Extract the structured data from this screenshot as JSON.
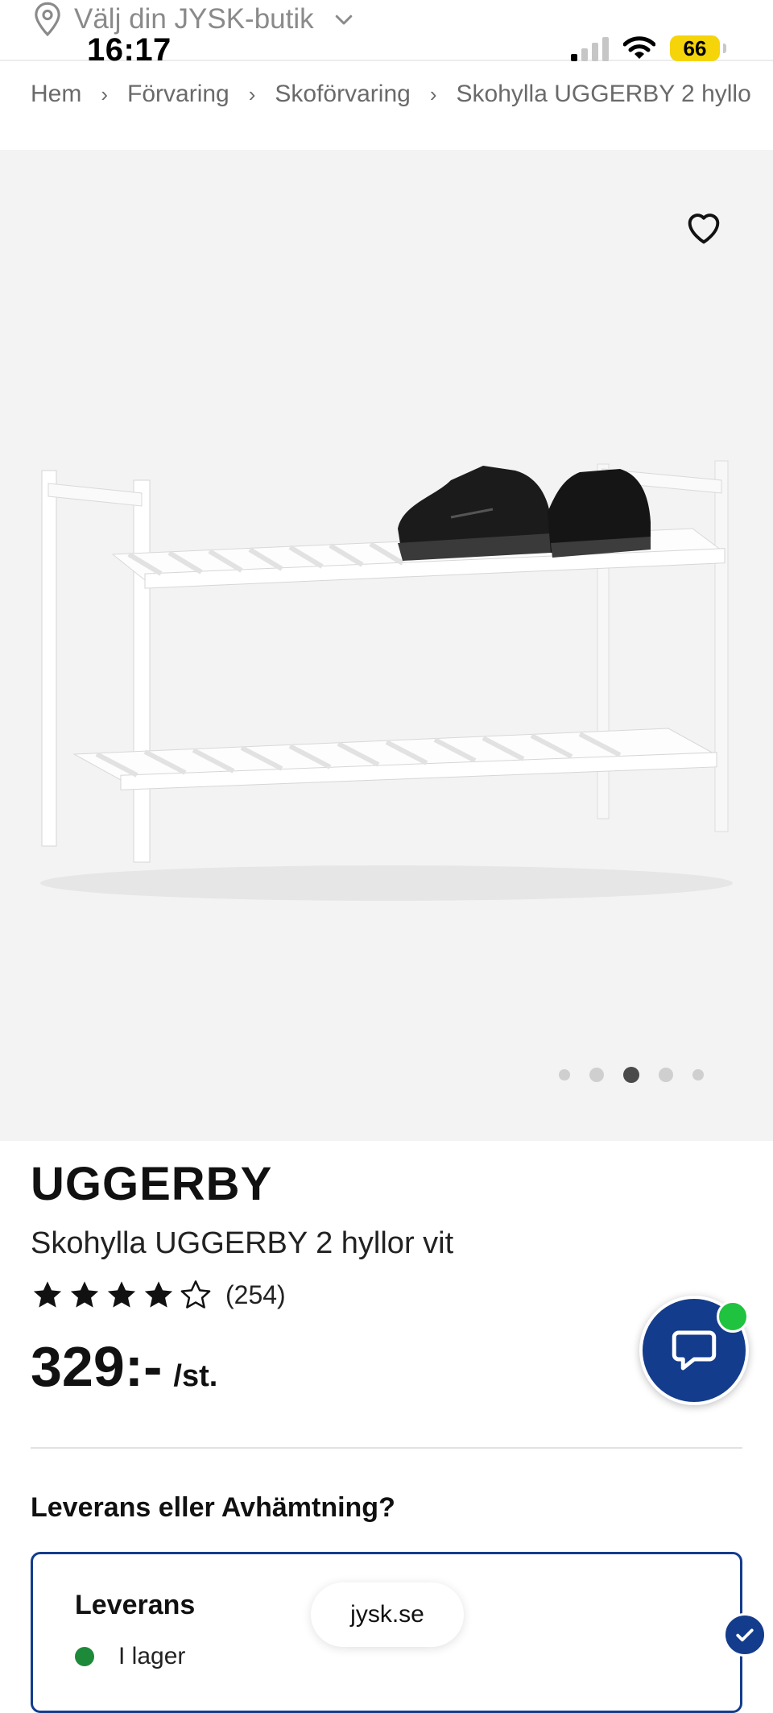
{
  "status_bar": {
    "time": "16:17",
    "battery": "66"
  },
  "store_selector": {
    "label": "Välj din JYSK-butik"
  },
  "breadcrumb": {
    "items": [
      "Hem",
      "Förvaring",
      "Skoförvaring",
      "Skohylla UGGERBY 2 hyllo"
    ],
    "separator": "›"
  },
  "gallery": {
    "image_count": 5,
    "active_index": 2
  },
  "product": {
    "brand": "UGGERBY",
    "name": "Skohylla UGGERBY 2 hyllor vit",
    "rating_stars": 4,
    "rating_max": 5,
    "review_count": "(254)",
    "price": "329:-",
    "price_unit": "/st."
  },
  "delivery": {
    "heading": "Leverans eller Avhämtning?",
    "option_title": "Leverans",
    "stock_status": "I lager"
  },
  "browser": {
    "url": "jysk.se"
  },
  "colors": {
    "brand_blue": "#143c8c",
    "online_green": "#1fc33f",
    "stock_green": "#1d8a3a",
    "battery_yellow": "#f5d40a"
  }
}
